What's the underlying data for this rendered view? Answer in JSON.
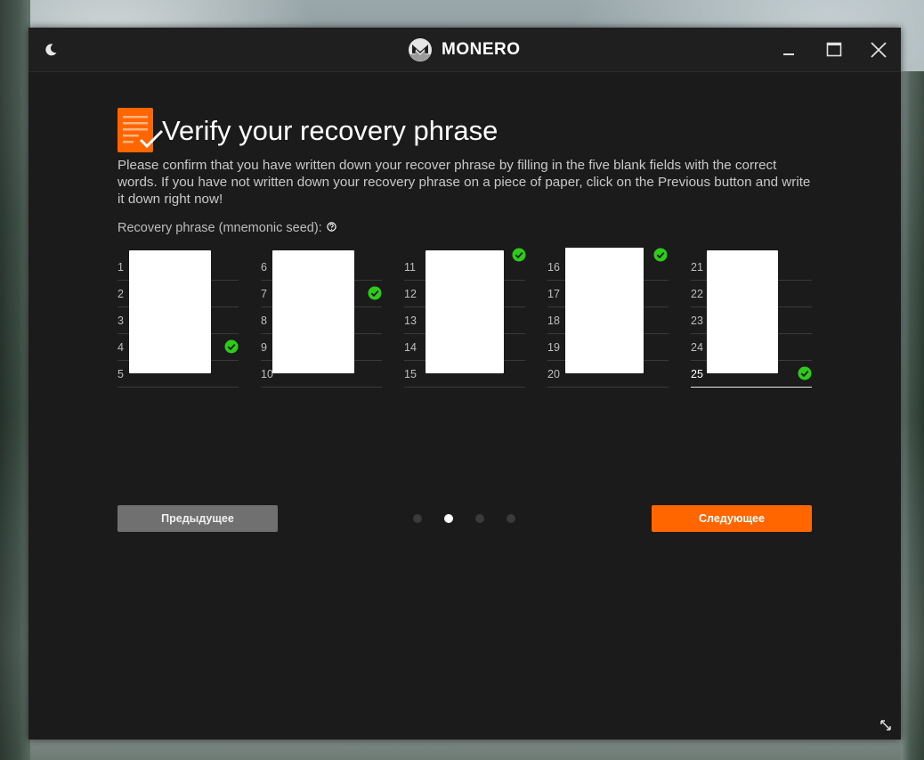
{
  "titlebar": {
    "app_name": "MONERO"
  },
  "page": {
    "title": "Verify your recovery phrase",
    "description": "Please confirm that you have written down your recover phrase by filling in the five blank fields with the correct words. If you have not written down your recovery phrase on a piece of paper, click on the Previous button and write it down right now!",
    "seed_label": "Recovery phrase (mnemonic seed):"
  },
  "seed": {
    "columns": [
      {
        "rows": [
          "1",
          "2",
          "3",
          "4",
          "5"
        ],
        "checked_index": 3,
        "active": false
      },
      {
        "rows": [
          "6",
          "7",
          "8",
          "9",
          "10"
        ],
        "checked_index": 1,
        "active": false
      },
      {
        "rows": [
          "11",
          "12",
          "13",
          "14",
          "15"
        ],
        "checked_index": 0,
        "active": false
      },
      {
        "rows": [
          "16",
          "17",
          "18",
          "19",
          "20"
        ],
        "checked_index": 0,
        "active": false
      },
      {
        "rows": [
          "21",
          "22",
          "23",
          "24",
          "25"
        ],
        "checked_index": 4,
        "active": true
      }
    ]
  },
  "navigation": {
    "previous_label": "Предыдущее",
    "next_label": "Следующее",
    "page_count": 4,
    "current_page": 2
  },
  "colors": {
    "accent": "#ff6600",
    "check": "#2ecc1a",
    "background": "#1b1b1b"
  }
}
